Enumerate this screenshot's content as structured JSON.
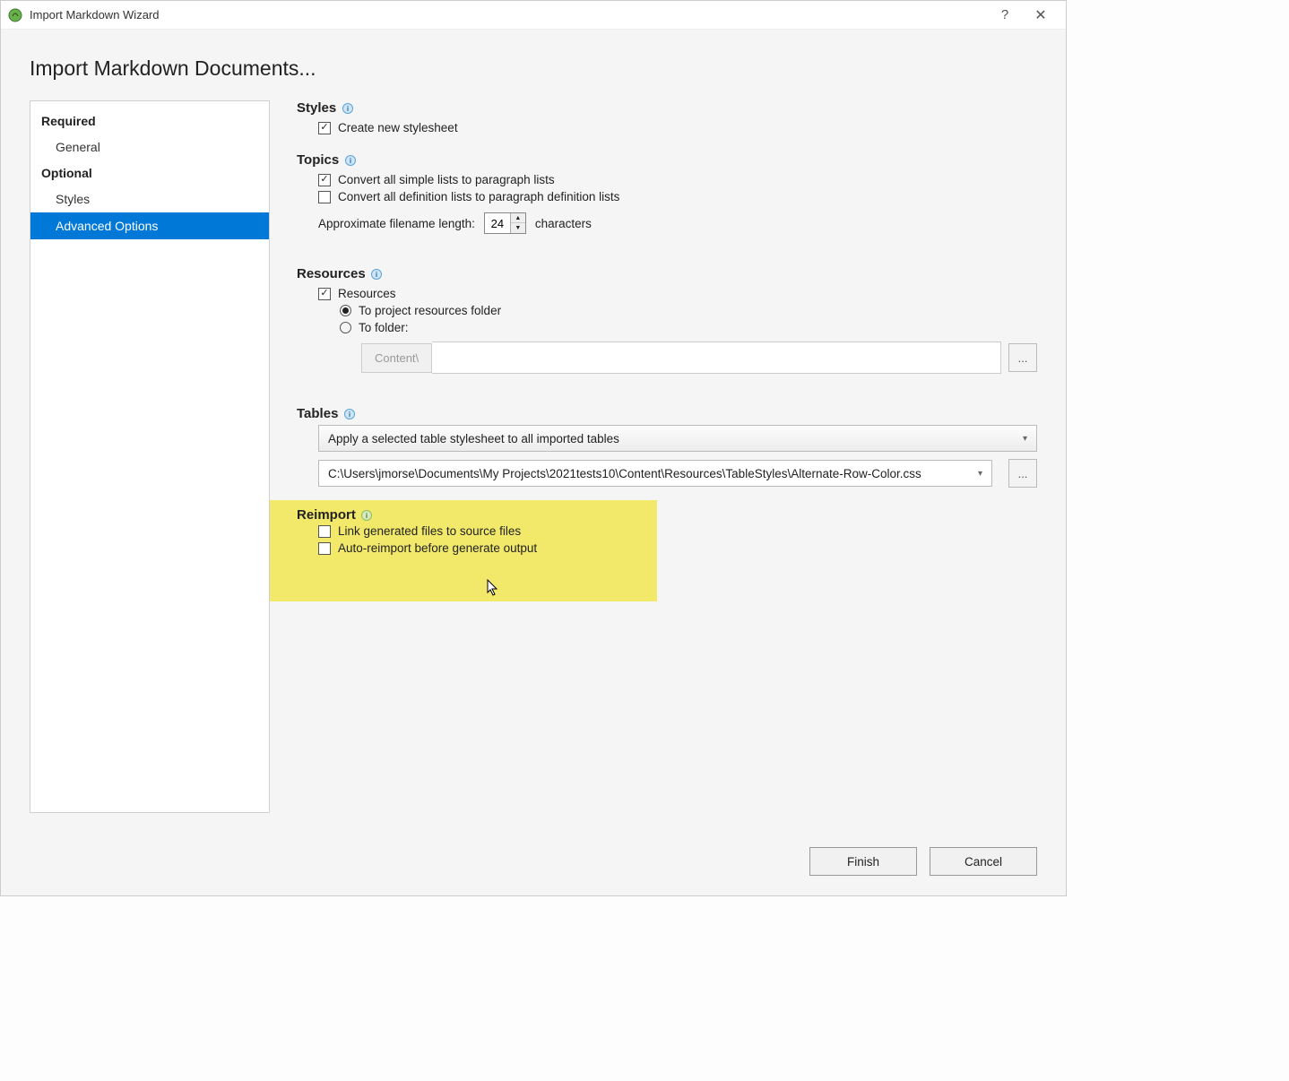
{
  "window": {
    "title": "Import Markdown Wizard"
  },
  "page": {
    "title": "Import Markdown Documents..."
  },
  "sidebar": {
    "required_label": "Required",
    "optional_label": "Optional",
    "items": {
      "general": "General",
      "styles": "Styles",
      "advanced": "Advanced Options"
    }
  },
  "styles": {
    "heading": "Styles",
    "create_stylesheet": "Create new stylesheet"
  },
  "topics": {
    "heading": "Topics",
    "convert_simple_lists": "Convert all simple lists to paragraph lists",
    "convert_definition_lists": "Convert all definition lists to paragraph definition lists",
    "filename_label": "Approximate filename length:",
    "filename_value": "24",
    "characters_label": "characters"
  },
  "resources": {
    "heading": "Resources",
    "enable": "Resources",
    "to_project": "To project resources folder",
    "to_folder": "To folder:",
    "folder_prefix": "Content\\",
    "folder_value": "",
    "browse": "..."
  },
  "tables": {
    "heading": "Tables",
    "mode": "Apply a selected table stylesheet to all imported tables",
    "path": "C:\\Users\\jmorse\\Documents\\My Projects\\2021tests10\\Content\\Resources\\TableStyles\\Alternate-Row-Color.css",
    "browse": "..."
  },
  "reimport": {
    "heading": "Reimport",
    "link_files": "Link generated files to source files",
    "auto_reimport": "Auto-reimport before generate output"
  },
  "footer": {
    "finish": "Finish",
    "cancel": "Cancel"
  }
}
